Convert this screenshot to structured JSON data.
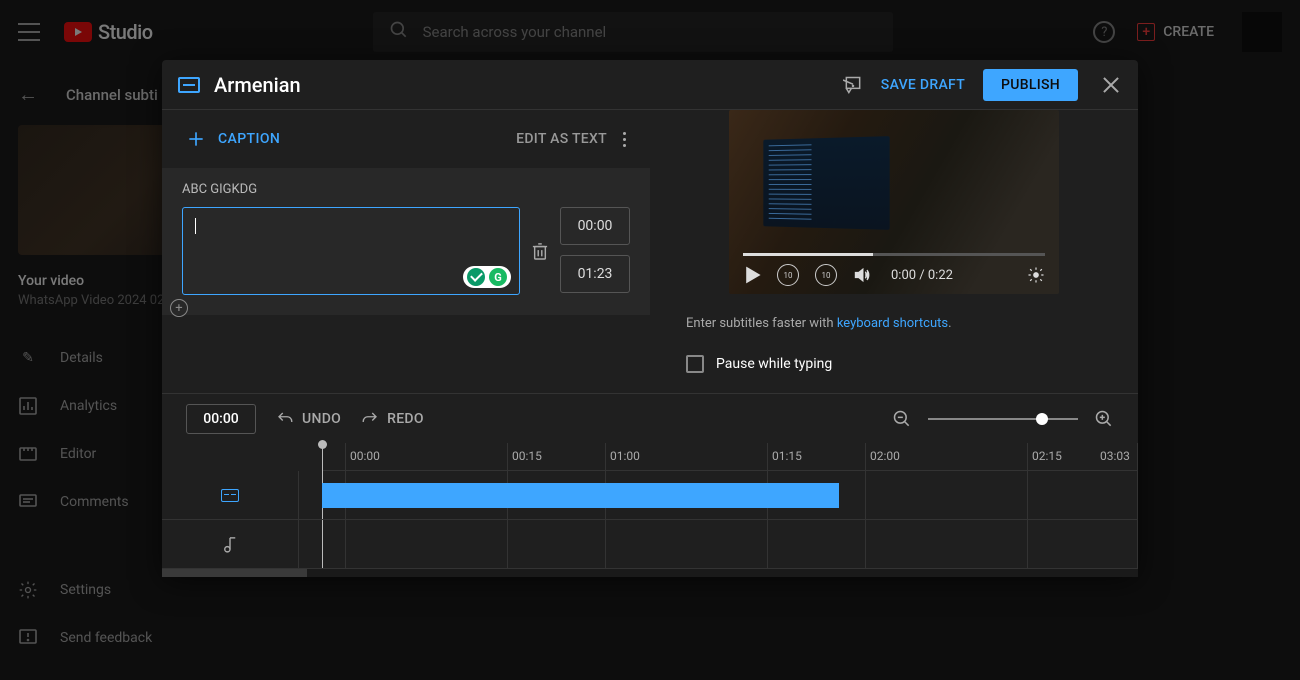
{
  "topbar": {
    "logo": "Studio",
    "search_placeholder": "Search across your channel",
    "create": "CREATE"
  },
  "background": {
    "back_title": "Channel subti",
    "your_video": "Your video",
    "video_name": "WhatsApp Video 2024 02",
    "nav": [
      "Details",
      "Analytics",
      "Editor",
      "Comments",
      "Settings",
      "Send feedback"
    ]
  },
  "modal": {
    "title": "Armenian",
    "save_draft": "SAVE DRAFT",
    "publish": "PUBLISH",
    "caption_btn": "CAPTION",
    "edit_as_text": "EDIT AS TEXT",
    "abc": "ABC GIGKDG",
    "start_time": "00:00",
    "end_time": "01:23",
    "video_time": "0:00 / 0:22",
    "hint_pre": "Enter subtitles faster with ",
    "hint_link": "keyboard shortcuts",
    "hint_post": ".",
    "pause_label": "Pause while typing",
    "toolbar_time": "00:00",
    "undo": "UNDO",
    "redo": "REDO",
    "ticks": [
      "00:00",
      "00:15",
      "01:00",
      "01:15",
      "02:00",
      "02:15",
      "03:03"
    ]
  }
}
